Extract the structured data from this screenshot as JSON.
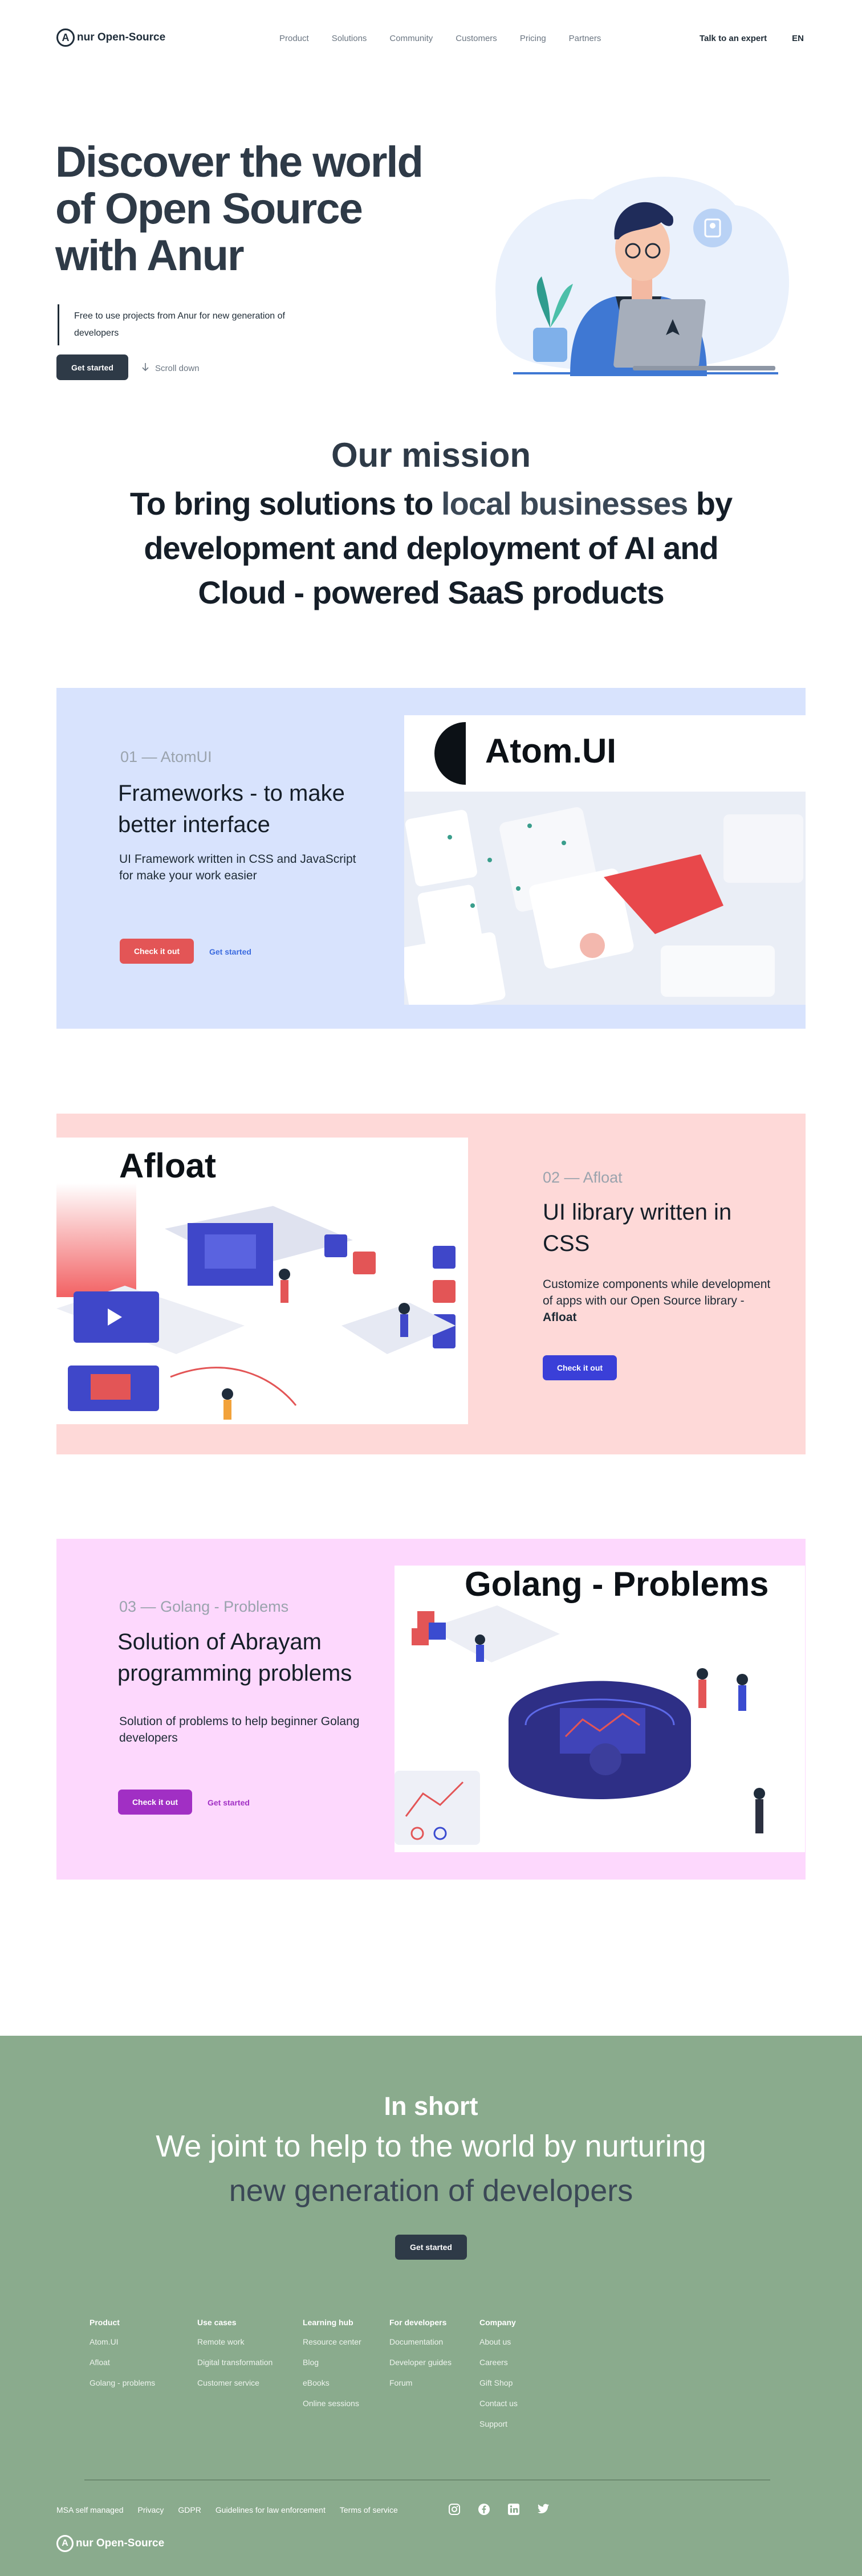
{
  "nav": {
    "logo_letter": "A",
    "logo_text": "nur Open-Source",
    "menu": [
      "Product",
      "Solutions",
      "Community",
      "Customers",
      "Pricing",
      "Partners"
    ],
    "talk": "Talk to an expert",
    "lang": "EN"
  },
  "hero": {
    "title": "Discover the world of Open Source with Anur",
    "subtitle": "Free to use projects from Anur for new generation of developers",
    "cta": "Get started",
    "scroll": "Scroll down"
  },
  "mission": {
    "heading": "Our mission",
    "text_before": "To bring solutions to ",
    "text_highlight": "local businesses",
    "text_after": " by development and deployment of AI and Cloud - powered SaaS products"
  },
  "cards": [
    {
      "num": "01",
      "dash": " — ",
      "name": "AtomUI",
      "title": "Frameworks -  to make better interface",
      "desc": "UI Framework written in CSS and JavaScript for make your work easier",
      "btn": "Check it out",
      "link": "Get started",
      "shot_label": "Atom.UI",
      "bg": "#d8e3fd",
      "accent": "#e35556",
      "link_color": "#3b6bdf"
    },
    {
      "num": "02",
      "dash": " — ",
      "name": "Afloat",
      "title": "UI library written in CSS",
      "desc_before": "Customize components while development of apps with our Open Source library - ",
      "desc_bold": "Afloat",
      "btn": "Check it out",
      "shot_label": "Afloat",
      "bg": "#fed9d8",
      "accent": "#3a3fd8"
    },
    {
      "num": "03",
      "dash": " — ",
      "name": "Golang - Problems",
      "title": "Solution of Abrayam programming problems",
      "desc": "Solution of problems to help beginner Golang developers",
      "btn": "Check it out",
      "link": "Get started",
      "shot_label": "Golang - Problems",
      "bg": "#fdd8fd",
      "accent": "#a12fc4",
      "link_color": "#a12fc4"
    }
  ],
  "footer": {
    "heading": "In short",
    "text_before": "We joint to help to the world by nurturing ",
    "text_highlight": "new generation of developers",
    "cta": "Get started",
    "columns": [
      {
        "title": "Product",
        "items": [
          "Atom.UI",
          "Afloat",
          "Golang - problems"
        ]
      },
      {
        "title": "Use cases",
        "items": [
          "Remote work",
          "Digital transformation",
          "Customer service"
        ]
      },
      {
        "title": "Learning hub",
        "items": [
          "Resource center",
          "Blog",
          "eBooks",
          "Online sessions"
        ]
      },
      {
        "title": "For developers",
        "items": [
          "Documentation",
          "Developer guides",
          "Forum"
        ]
      },
      {
        "title": "Company",
        "items": [
          "About us",
          "Careers",
          "Gift Shop",
          "Contact us",
          "Support"
        ]
      }
    ],
    "bottom_links": [
      "MSA self managed",
      "Privacy",
      "GDPR",
      "Guidelines for law enforcement",
      "Terms of service"
    ],
    "social": [
      "instagram-icon",
      "facebook-icon",
      "linkedin-icon",
      "twitter-icon"
    ],
    "logo_letter": "A",
    "logo_text": "nur Open-Source"
  }
}
